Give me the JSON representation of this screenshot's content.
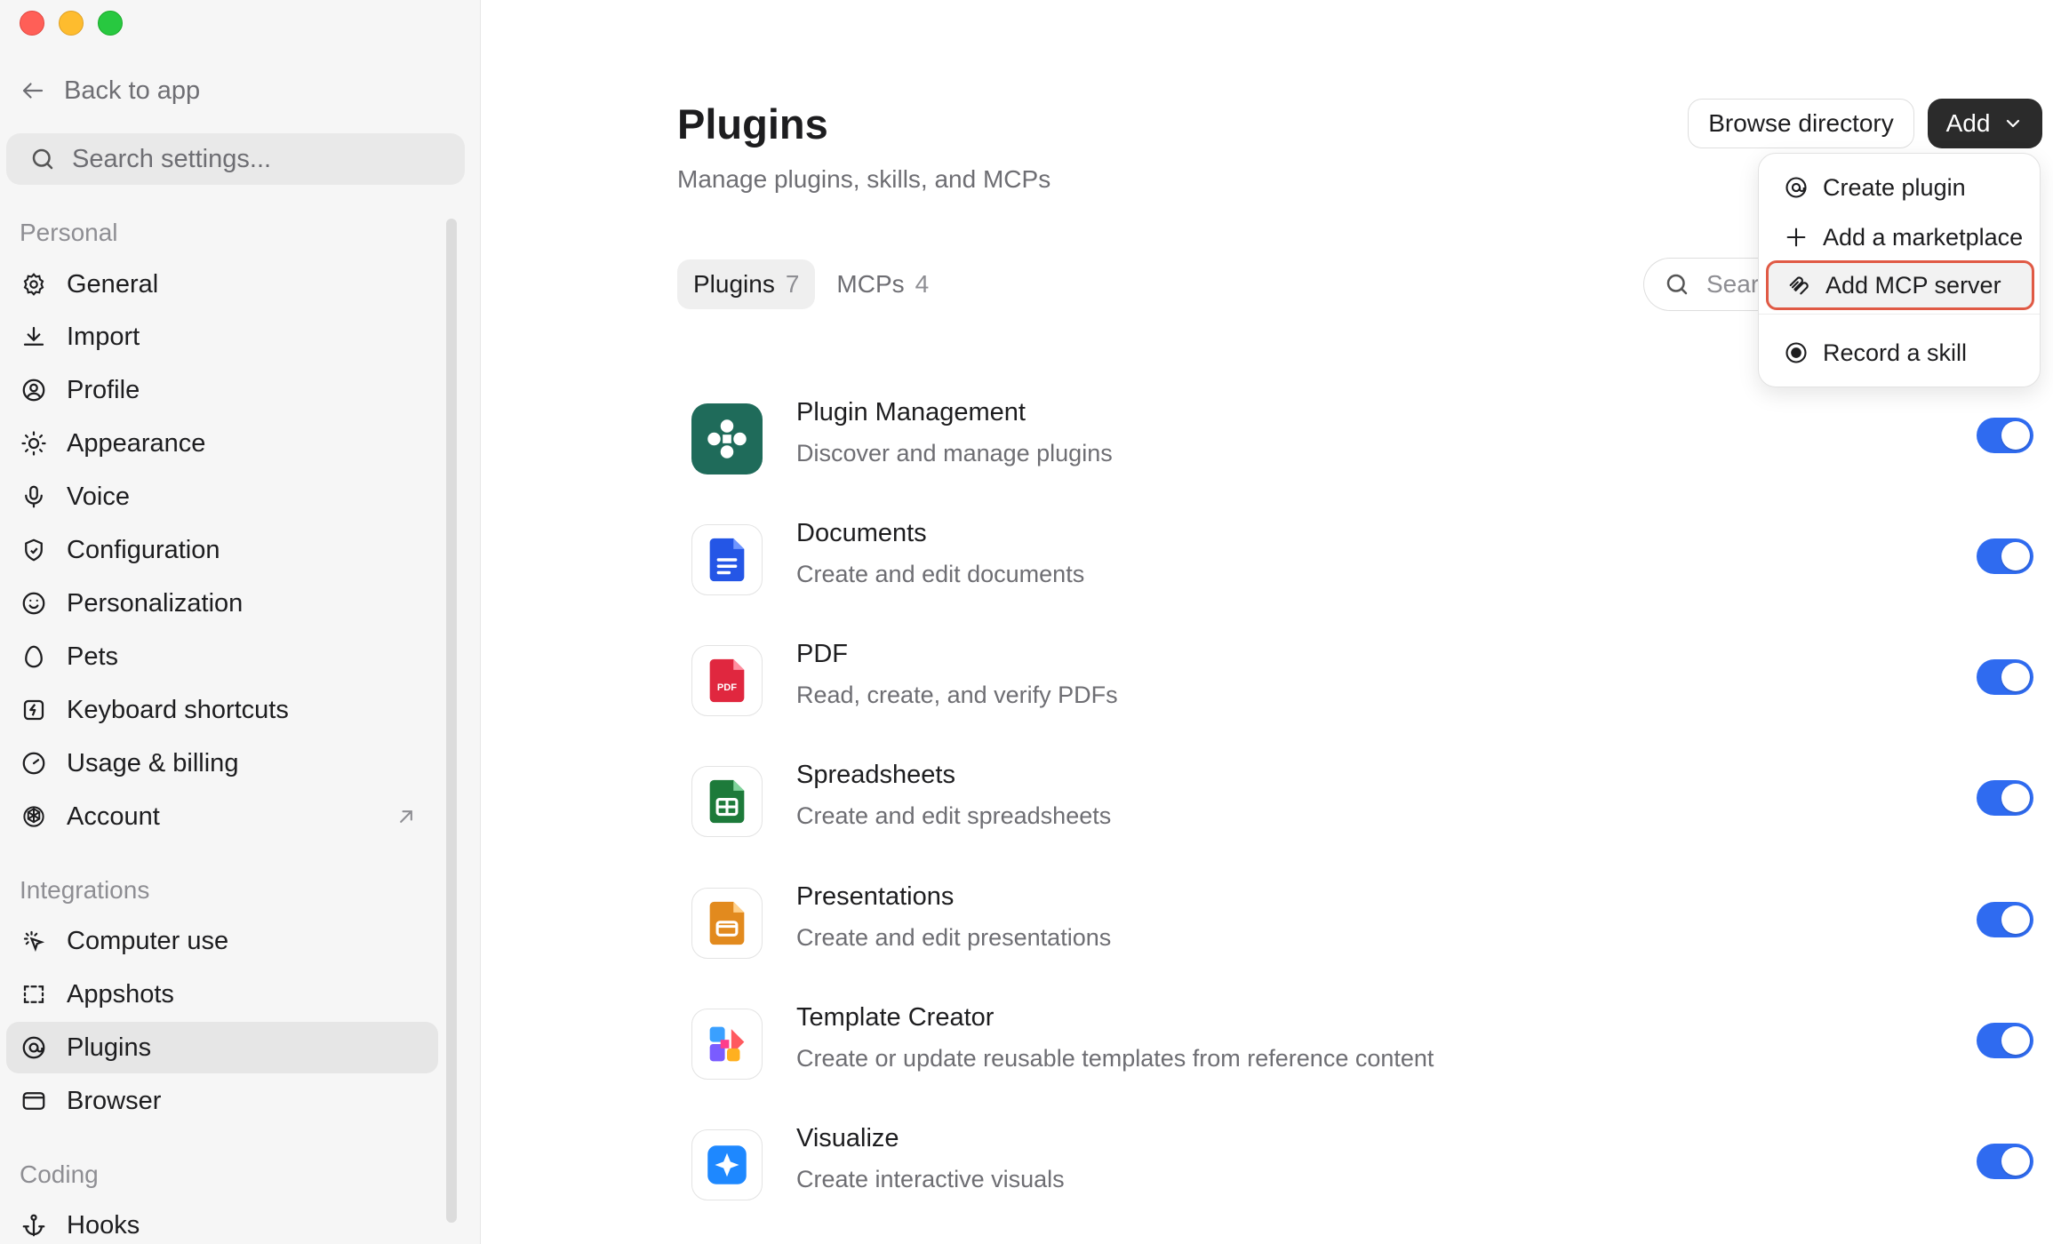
{
  "sidebar": {
    "back_label": "Back to app",
    "search_placeholder": "Search settings...",
    "sections": {
      "personal": "Personal",
      "integrations": "Integrations",
      "coding": "Coding"
    },
    "personal_items": [
      "General",
      "Import",
      "Profile",
      "Appearance",
      "Voice",
      "Configuration",
      "Personalization",
      "Pets",
      "Keyboard shortcuts",
      "Usage & billing",
      "Account"
    ],
    "integration_items": [
      "Computer use",
      "Appshots",
      "Plugins",
      "Browser"
    ],
    "coding_items": [
      "Hooks"
    ],
    "active_item": "Plugins"
  },
  "main": {
    "title": "Plugins",
    "subtitle": "Manage plugins, skills, and MCPs",
    "browse_button": "Browse directory",
    "add_button": "Add",
    "tabs": [
      {
        "label": "Plugins",
        "count": "7"
      },
      {
        "label": "MCPs",
        "count": "4"
      }
    ],
    "search_placeholder": "Search"
  },
  "plugins": [
    {
      "name": "Plugin Management",
      "desc": "Discover and manage plugins",
      "enabled": true,
      "icon": "plugin-management-icon"
    },
    {
      "name": "Documents",
      "desc": "Create and edit documents",
      "enabled": true,
      "icon": "documents-icon"
    },
    {
      "name": "PDF",
      "desc": "Read, create, and verify PDFs",
      "enabled": true,
      "icon": "pdf-icon",
      "icon_text": "PDF"
    },
    {
      "name": "Spreadsheets",
      "desc": "Create and edit spreadsheets",
      "enabled": true,
      "icon": "spreadsheets-icon"
    },
    {
      "name": "Presentations",
      "desc": "Create and edit presentations",
      "enabled": true,
      "icon": "presentations-icon"
    },
    {
      "name": "Template Creator",
      "desc": "Create or update reusable templates from reference content",
      "enabled": true,
      "icon": "template-creator-icon"
    },
    {
      "name": "Visualize",
      "desc": "Create interactive visuals",
      "enabled": true,
      "icon": "visualize-icon"
    }
  ],
  "add_menu": {
    "items": [
      "Create plugin",
      "Add a marketplace",
      "Add MCP server",
      "Record a skill"
    ],
    "highlighted": "Add MCP server"
  },
  "colors": {
    "toggle_on": "#2f6bf0",
    "add_button_bg": "#2b2b2b",
    "highlight_border": "#e05a45",
    "sidebar_bg": "#f6f6f6"
  }
}
